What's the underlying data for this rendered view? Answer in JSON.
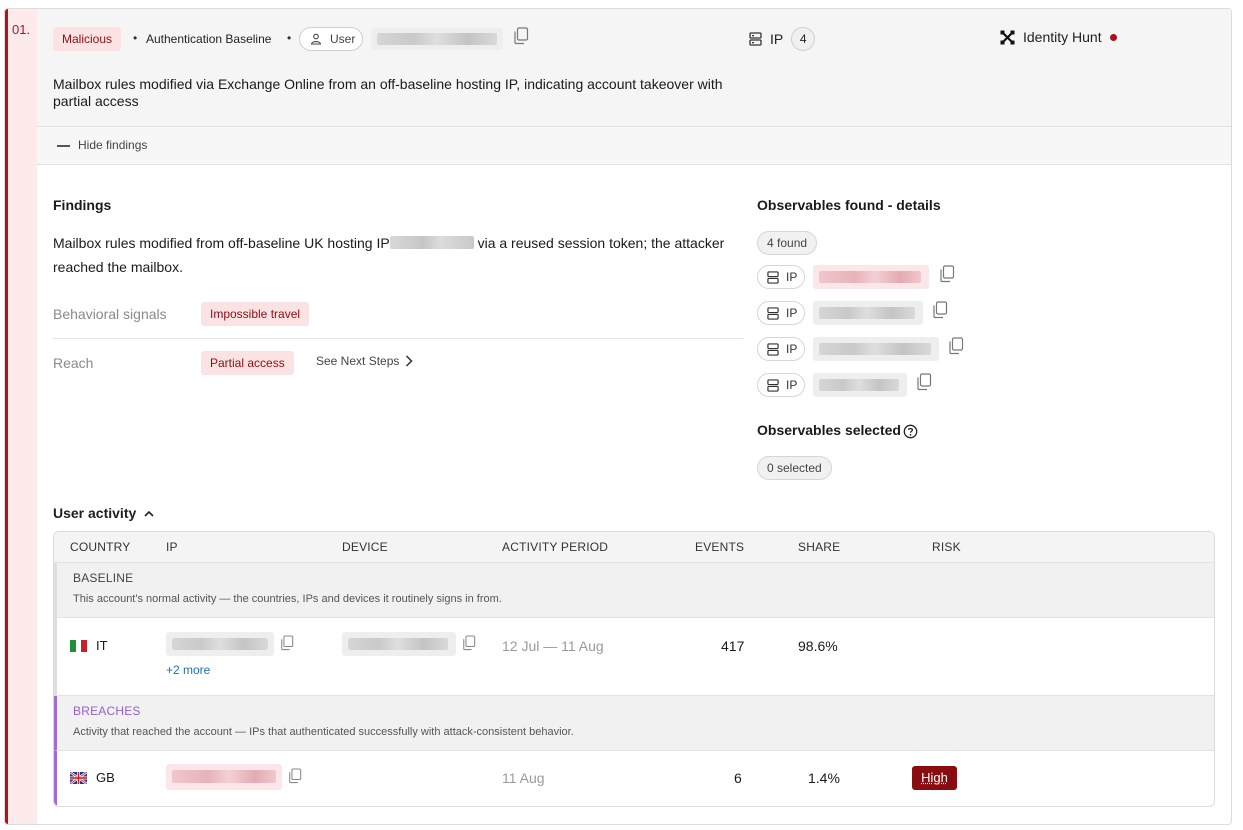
{
  "incident": {
    "number": "01.",
    "verdict": "Malicious",
    "source": "Authentication Baseline",
    "entity_type": "User",
    "ip_label": "IP",
    "ip_count": "4",
    "hunt_label": "Identity Hunt",
    "summary": "Mailbox rules modified via Exchange Online from an off-baseline hosting IP, indicating account takeover with partial access"
  },
  "toggle": {
    "label": "Hide findings"
  },
  "findings": {
    "title": "Findings",
    "text_before": "Mailbox rules modified from off-baseline UK hosting IP",
    "text_after": " via a reused session token; the attacker reached the mailbox.",
    "signals_label": "Behavioral signals",
    "signals_value": "Impossible travel",
    "reach_label": "Reach",
    "reach_value": "Partial access",
    "next_steps": "See Next Steps"
  },
  "observables": {
    "title": "Observables found - details",
    "found": "4 found",
    "items": [
      {
        "type": "IP",
        "flagged": true
      },
      {
        "type": "IP",
        "flagged": false
      },
      {
        "type": "IP",
        "flagged": false
      },
      {
        "type": "IP",
        "flagged": false
      }
    ],
    "selected_title": "Observables selected",
    "selected_count": "0 selected"
  },
  "activity": {
    "title": "User activity",
    "columns": [
      "COUNTRY",
      "IP",
      "DEVICE",
      "ACTIVITY PERIOD",
      "EVENTS",
      "SHARE",
      "RISK"
    ],
    "baseline": {
      "name": "BASELINE",
      "description": "This account's normal activity — the countries, IPs and devices it routinely signs in from.",
      "rows": [
        {
          "country": "IT",
          "period": "12 Jul — 11 Aug",
          "events": "417",
          "share": "98.6%",
          "more": "+2 more"
        }
      ]
    },
    "breaches": {
      "name": "BREACHES",
      "description": "Activity that reached the account — IPs that authenticated successfully with attack-consistent behavior.",
      "rows": [
        {
          "country": "GB",
          "period": "11 Aug",
          "events": "6",
          "share": "1.4%",
          "risk": "High"
        }
      ]
    }
  },
  "colors": {
    "accent": "#b3121d",
    "risk_high": "#8a0b10",
    "breach": "#a06bd6",
    "link": "#1f6fb7"
  }
}
